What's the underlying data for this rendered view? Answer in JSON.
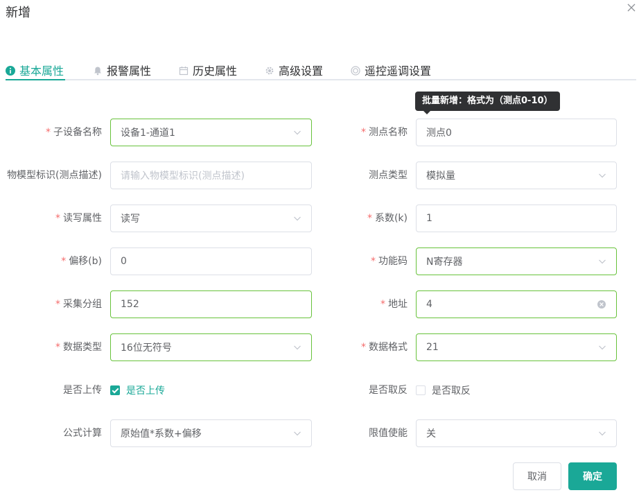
{
  "dialog": {
    "title": "新增"
  },
  "tabs": [
    {
      "label": "基本属性",
      "icon": "info-icon",
      "active": true
    },
    {
      "label": "报警属性",
      "icon": "bell-icon",
      "active": false
    },
    {
      "label": "历史属性",
      "icon": "calendar-icon",
      "active": false
    },
    {
      "label": "高级设置",
      "icon": "gear-icon",
      "active": false
    },
    {
      "label": "遥控遥调设置",
      "icon": "remote-icon",
      "active": false
    }
  ],
  "tooltip": {
    "text": "批量新增：格式为（测点0-10）"
  },
  "form": {
    "sub_device_name": {
      "label": "子设备名称",
      "value": "设备1-通道1"
    },
    "point_name": {
      "label": "测点名称",
      "value": "测点0"
    },
    "model_id": {
      "label": "物模型标识(测点描述)",
      "placeholder": "请输入物模型标识(测点描述)"
    },
    "point_type": {
      "label": "测点类型",
      "value": "模拟量"
    },
    "rw_attr": {
      "label": "读写属性",
      "value": "读写"
    },
    "coefficient": {
      "label": "系数(k)",
      "value": "1"
    },
    "offset": {
      "label": "偏移(b)",
      "value": "0"
    },
    "function_code": {
      "label": "功能码",
      "value": "N寄存器"
    },
    "collect_group": {
      "label": "采集分组",
      "value": "152"
    },
    "address": {
      "label": "地址",
      "value": "4"
    },
    "data_type": {
      "label": "数据类型",
      "value": "16位无符号"
    },
    "data_format": {
      "label": "数据格式",
      "value": "21"
    },
    "upload": {
      "label": "是否上传",
      "text": "是否上传",
      "checked": true
    },
    "invert": {
      "label": "是否取反",
      "text": "是否取反",
      "checked": false
    },
    "formula": {
      "label": "公式计算",
      "value": "原始值*系数+偏移"
    },
    "limit_enable": {
      "label": "限值使能",
      "value": "关"
    }
  },
  "buttons": {
    "cancel": "取消",
    "confirm": "确定"
  },
  "colors": {
    "accent": "#1aa897",
    "success_border": "#67c23a",
    "required": "#f56c6c",
    "tooltip_bg": "#303133"
  }
}
